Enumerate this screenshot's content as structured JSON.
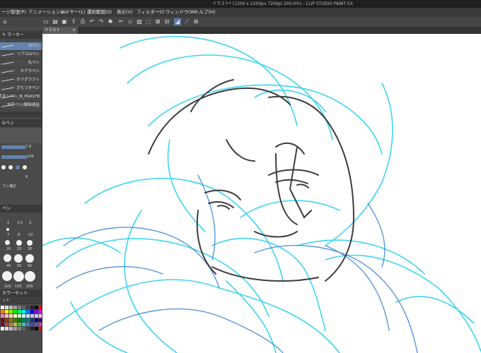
{
  "app": {
    "title": "イラスト* (1200 x 2200px 720dpi 200.0%) - CLIP STUDIO PAINT EX"
  },
  "menu": [
    {
      "label": "ージ管理(P)"
    },
    {
      "label": "アニメーション(A)"
    },
    {
      "label": "レイヤー(L)"
    },
    {
      "label": "選択範囲(S)"
    },
    {
      "label": "表示(V)"
    },
    {
      "label": "フィルター(I)"
    },
    {
      "label": "ウィンドウ(W)"
    },
    {
      "label": "ヘルプ(H)"
    }
  ],
  "sub_tool": {
    "title": "マーカー"
  },
  "brushes": [
    {
      "label": "Gペン"
    },
    {
      "label": "リアルGペン"
    },
    {
      "label": "丸ペン"
    },
    {
      "label": "カブラペン"
    },
    {
      "label": "カリグラフィ"
    },
    {
      "label": "ざらつきペン"
    },
    {
      "label": "ボオンペン_B_PG0278"
    },
    {
      "label": "文字ペン/解除遅延"
    }
  ],
  "tool_property": {
    "header": "Gペン",
    "size_value": "7.8",
    "opacity_value": "100",
    "stabilize_value": "6",
    "correction_label": "ブレ補正"
  },
  "brush_size": {
    "header": "ペン",
    "sizes": [
      "2",
      "2.5",
      "3",
      "7",
      "8",
      "10",
      "20",
      "25",
      "30",
      "40",
      "50",
      "60",
      "100",
      "150",
      "200"
    ]
  },
  "color_set": {
    "header": "カラーセット",
    "name": "ット"
  },
  "document_tab": {
    "label": "イラスト"
  },
  "colors": {
    "accent": "#6484ad",
    "sketch_cyan": "#2ad0ee",
    "sketch_blue": "#3d83d6",
    "lineart": "#333333"
  }
}
